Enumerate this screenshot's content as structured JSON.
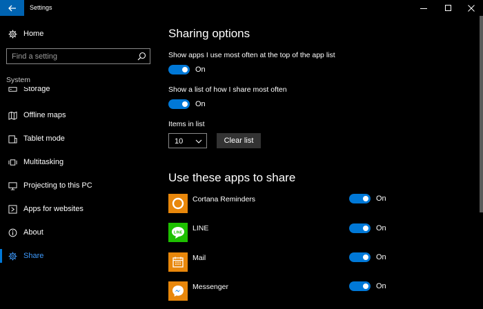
{
  "window": {
    "title": "Settings"
  },
  "colors": {
    "accent": "#0078d7",
    "titlebar_back": "#0063b1",
    "active_text": "#3e9bff"
  },
  "sidebar": {
    "home_label": "Home",
    "search_placeholder": "Find a setting",
    "section_label": "System",
    "items": [
      {
        "label": "Storage",
        "icon": "storage-icon"
      },
      {
        "label": "Offline maps",
        "icon": "map-icon"
      },
      {
        "label": "Tablet mode",
        "icon": "tablet-icon"
      },
      {
        "label": "Multitasking",
        "icon": "multitasking-icon"
      },
      {
        "label": "Projecting to this PC",
        "icon": "projector-icon"
      },
      {
        "label": "Apps for websites",
        "icon": "web-app-icon"
      },
      {
        "label": "About",
        "icon": "info-icon"
      },
      {
        "label": "Share",
        "icon": "gear-icon",
        "active": true
      }
    ]
  },
  "main": {
    "section1_title": "Sharing options",
    "setting1": {
      "label": "Show apps I use most often at the top of the app list",
      "state": "On"
    },
    "setting2": {
      "label": "Show a list of how I share most often",
      "state": "On"
    },
    "items_in_list": {
      "label": "Items in list",
      "value": "10"
    },
    "clear_button": "Clear list",
    "section2_title": "Use these apps to share",
    "apps": [
      {
        "name": "Cortana Reminders",
        "state": "On",
        "icon": "cortana-icon"
      },
      {
        "name": "LINE",
        "state": "On",
        "icon": "line-icon"
      },
      {
        "name": "Mail",
        "state": "On",
        "icon": "mail-icon"
      },
      {
        "name": "Messenger",
        "state": "On",
        "icon": "messenger-icon"
      }
    ]
  }
}
